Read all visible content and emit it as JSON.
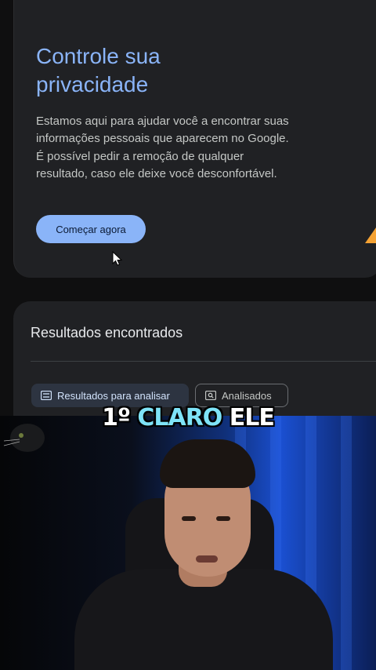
{
  "privacy_card": {
    "title": "Controle sua privacidade",
    "description": "Estamos aqui para ajudar você a encontrar suas informações pessoais que aparecem no Google. É possível pedir a remoção de qualquer resultado, caso ele deixe você desconfortável.",
    "start_button": "Começar agora"
  },
  "results_card": {
    "title": "Resultados encontrados",
    "chips": [
      {
        "label": "Resultados para analisar",
        "icon": "list-icon",
        "selected": true
      },
      {
        "label": "Analisados",
        "icon": "review-icon",
        "selected": false
      }
    ]
  },
  "caption": {
    "part1": "1º",
    "highlight": "CLARO",
    "part2": "ELE"
  },
  "colors": {
    "accent_blue": "#8ab4f8",
    "card_bg": "#202124",
    "caption_highlight": "#7ee3f7"
  }
}
